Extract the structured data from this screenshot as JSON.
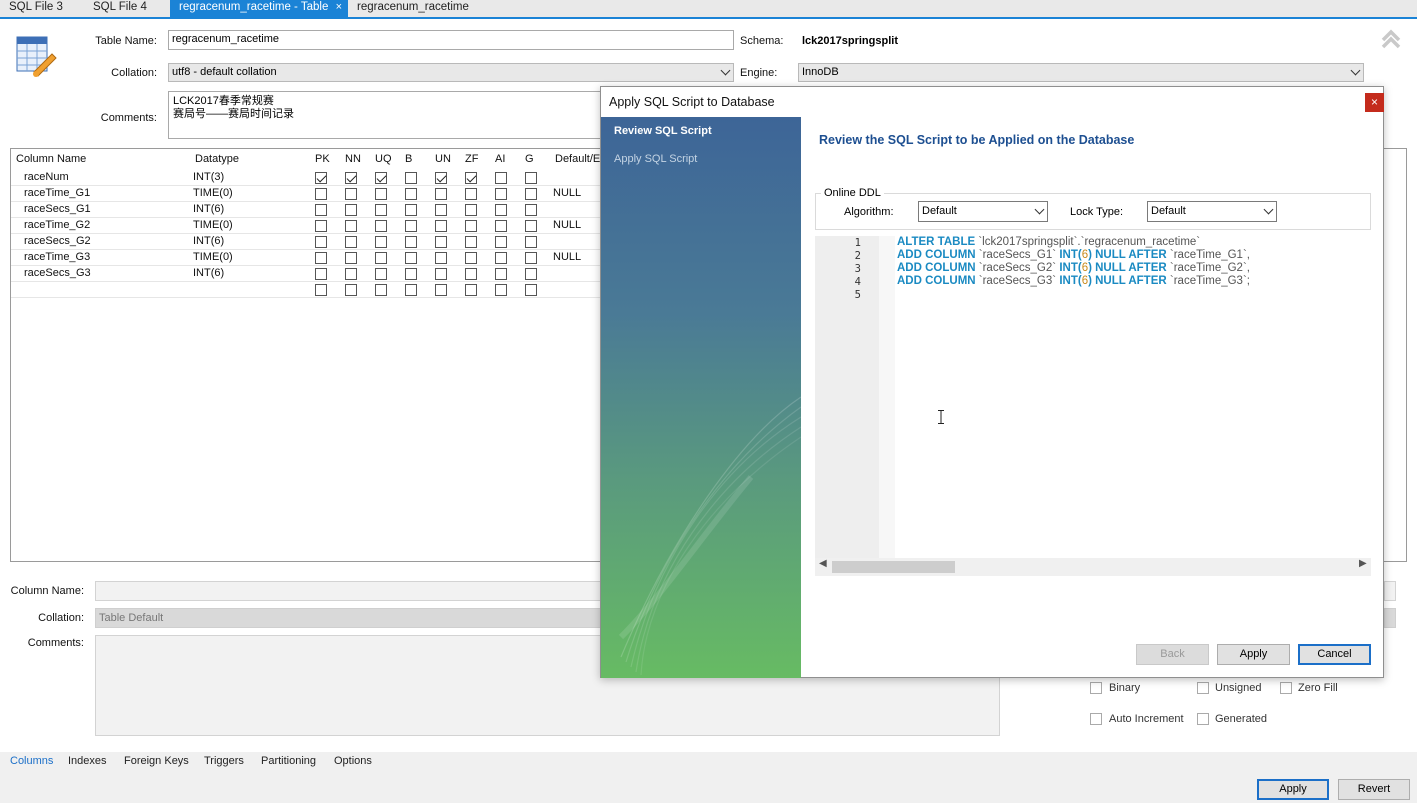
{
  "tabs": [
    {
      "label": "SQL File 3"
    },
    {
      "label": "SQL File 4"
    },
    {
      "label": "regracenum_racetime - Table",
      "close": "×"
    },
    {
      "label": "regracenum_racetime"
    }
  ],
  "table": {
    "name_label": "Table Name:",
    "name_value": "regracenum_racetime",
    "schema_label": "Schema:",
    "schema_value": "lck2017springsplit",
    "collation_label": "Collation:",
    "collation_value": "utf8 - default collation",
    "engine_label": "Engine:",
    "engine_value": "InnoDB",
    "comments_label": "Comments:",
    "comments_line1": "LCK2017春季常规赛",
    "comments_line2": "赛局号——赛局时间记录"
  },
  "grid": {
    "headers": [
      "Column Name",
      "Datatype",
      "PK",
      "NN",
      "UQ",
      "B",
      "UN",
      "ZF",
      "AI",
      "G",
      "Default/E"
    ],
    "rows": [
      {
        "name": "raceNum",
        "type": "INT(3)",
        "flags": [
          1,
          1,
          1,
          0,
          1,
          1,
          0,
          0
        ],
        "default": ""
      },
      {
        "name": "raceTime_G1",
        "type": "TIME(0)",
        "flags": [
          0,
          0,
          0,
          0,
          0,
          0,
          0,
          0
        ],
        "default": "NULL"
      },
      {
        "name": "raceSecs_G1",
        "type": "INT(6)",
        "flags": [
          0,
          0,
          0,
          0,
          0,
          0,
          0,
          0
        ],
        "default": ""
      },
      {
        "name": "raceTime_G2",
        "type": "TIME(0)",
        "flags": [
          0,
          0,
          0,
          0,
          0,
          0,
          0,
          0
        ],
        "default": "NULL"
      },
      {
        "name": "raceSecs_G2",
        "type": "INT(6)",
        "flags": [
          0,
          0,
          0,
          0,
          0,
          0,
          0,
          0
        ],
        "default": ""
      },
      {
        "name": "raceTime_G3",
        "type": "TIME(0)",
        "flags": [
          0,
          0,
          0,
          0,
          0,
          0,
          0,
          0
        ],
        "default": "NULL"
      },
      {
        "name": "raceSecs_G3",
        "type": "INT(6)",
        "flags": [
          0,
          0,
          0,
          0,
          0,
          0,
          0,
          0
        ],
        "default": ""
      },
      {
        "name": "",
        "type": "",
        "flags": [
          0,
          0,
          0,
          0,
          0,
          0,
          0,
          0
        ],
        "default": ""
      }
    ]
  },
  "details": {
    "column_name_label": "Column Name:",
    "collation_label": "Collation:",
    "collation_value": "Table Default",
    "comments_label": "Comments:",
    "binary": "Binary",
    "unsigned": "Unsigned",
    "zero_fill": "Zero Fill",
    "auto_increment": "Auto Increment",
    "generated": "Generated"
  },
  "bottom_tabs": [
    "Columns",
    "Indexes",
    "Foreign Keys",
    "Triggers",
    "Partitioning",
    "Options"
  ],
  "footer": {
    "apply": "Apply",
    "revert": "Revert"
  },
  "dialog": {
    "title": "Apply SQL Script to Database",
    "close": "×",
    "steps": [
      "Review SQL Script",
      "Apply SQL Script"
    ],
    "heading": "Review the SQL Script to be Applied on the Database",
    "online_ddl": "Online DDL",
    "algorithm_label": "Algorithm:",
    "algorithm_value": "Default",
    "lock_label": "Lock Type:",
    "lock_value": "Default",
    "line_numbers": [
      "1",
      "2",
      "3",
      "4",
      "5"
    ],
    "sql": {
      "l1_kw": "ALTER TABLE",
      "l1_rest": " `lck2017springsplit`.`regracenum_racetime`",
      "l2_kw": "ADD COLUMN",
      "l2_col": " `raceSecs_G1` ",
      "l2_int": "INT",
      "l2_num": "6",
      "l2_null": "NULL AFTER",
      "l2_after": " `raceTime_G1`,",
      "l3_kw": "ADD COLUMN",
      "l3_col": " `raceSecs_G2` ",
      "l3_int": "INT",
      "l3_num": "6",
      "l3_null": "NULL AFTER",
      "l3_after": " `raceTime_G2`,",
      "l4_kw": "ADD COLUMN",
      "l4_col": " `raceSecs_G3` ",
      "l4_int": "INT",
      "l4_num": "6",
      "l4_null": "NULL AFTER",
      "l4_after": " `raceTime_G3`;"
    },
    "buttons": {
      "back": "Back",
      "apply": "Apply",
      "cancel": "Cancel"
    }
  }
}
